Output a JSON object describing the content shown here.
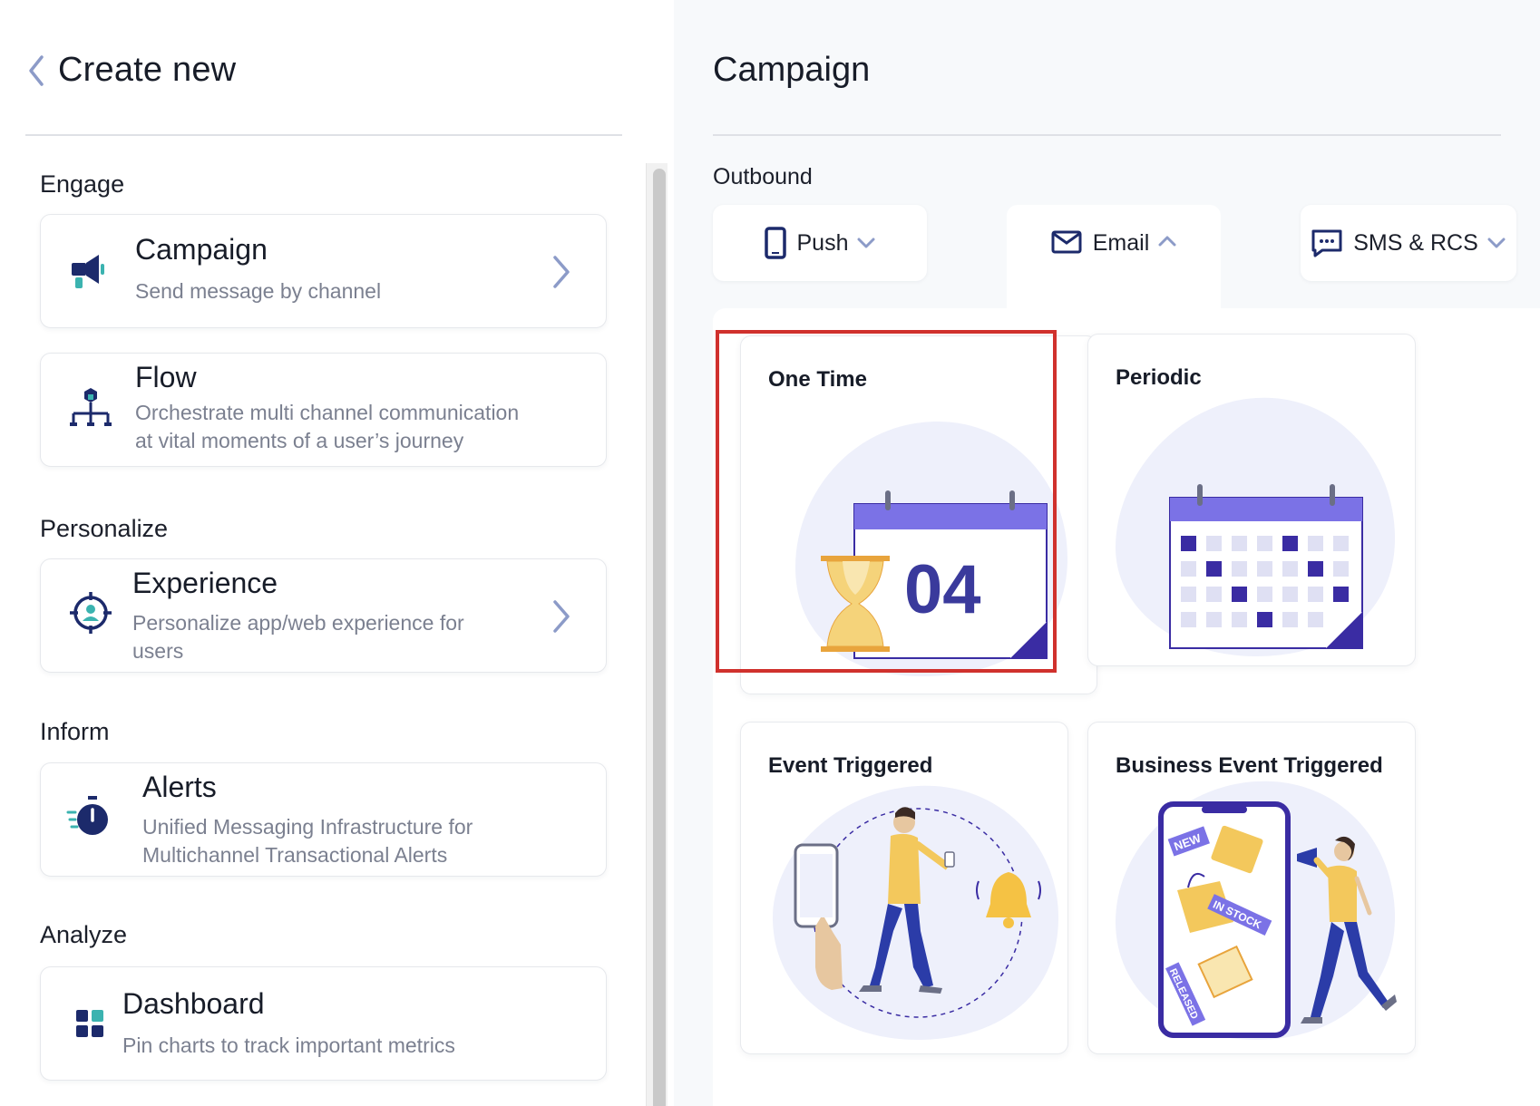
{
  "left": {
    "title": "Create new",
    "sections": {
      "engage": "Engage",
      "personalize": "Personalize",
      "inform": "Inform",
      "analyze": "Analyze"
    },
    "cards": {
      "campaign": {
        "title": "Campaign",
        "desc": "Send message by channel",
        "icon": "megaphone-icon"
      },
      "flow": {
        "title": "Flow",
        "desc1": "Orchestrate multi channel communication",
        "desc2": "at vital moments of a user’s journey",
        "icon": "flow-hierarchy-icon"
      },
      "experience": {
        "title": "Experience",
        "desc1": "Personalize app/web experience for",
        "desc2": "users",
        "icon": "target-user-icon"
      },
      "alerts": {
        "title": "Alerts",
        "desc1": "Unified Messaging Infrastructure for",
        "desc2": "Multichannel Transactional Alerts",
        "icon": "stopwatch-icon"
      },
      "dashboard": {
        "title": "Dashboard",
        "desc": "Pin charts to track important metrics",
        "icon": "dashboard-grid-icon"
      }
    }
  },
  "right": {
    "title": "Campaign",
    "outbound_label": "Outbound",
    "tabs": [
      {
        "label": "Push",
        "icon": "mobile-phone-icon",
        "state": "collapsed"
      },
      {
        "label": "Email",
        "icon": "envelope-icon",
        "state": "expanded"
      },
      {
        "label": "SMS & RCS",
        "icon": "chat-bubble-icon",
        "state": "collapsed"
      }
    ],
    "tiles": {
      "one_time": {
        "title": "One Time",
        "calendar_number": "04",
        "selected": true
      },
      "periodic": {
        "title": "Periodic"
      },
      "event_triggered": {
        "title": "Event Triggered"
      },
      "business_event": {
        "title": "Business Event Triggered",
        "tags": {
          "new": "NEW",
          "in_stock": "IN STOCK",
          "released": "RELEASED"
        }
      }
    }
  },
  "colors": {
    "accent_purple": "#7b72e6",
    "deep_purple": "#3a2ca3",
    "navy": "#1c2a6b",
    "teal": "#3bb3b0",
    "selection_red": "#d0312d",
    "amber": "#f3c85c"
  }
}
